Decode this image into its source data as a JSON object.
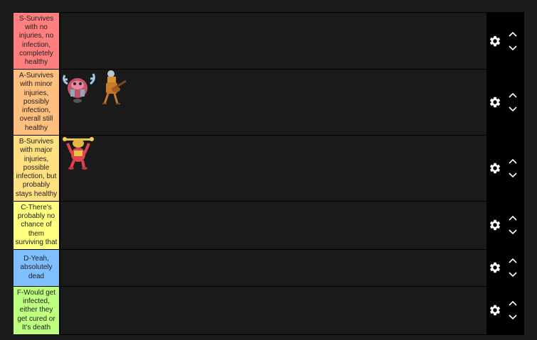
{
  "colors": {
    "background": "#1c1c1c",
    "row_bg": "#1a1a1a",
    "controls_bg": "#000000"
  },
  "tiers": [
    {
      "label": "S-Survives with no injuries, no infection, completely healthy",
      "color": "#ff7f7f"
    },
    {
      "label": "A-Survives with minor injuries, possibly infection, overall still healthy",
      "color": "#ffbf7f"
    },
    {
      "label": "B-Survives with major injuries, possible infection, but probably stays healthy",
      "color": "#ffdf7f"
    },
    {
      "label": "C-There's probably no chance of them surviving that",
      "color": "#ffff7f"
    },
    {
      "label": "D-Yeah, absolutely dead",
      "color": "#7fbfff"
    },
    {
      "label": "F-Would get infected, either they get cured or It's death",
      "color": "#bfff7f"
    }
  ],
  "icons": {
    "settings": "gear-icon",
    "move_up": "chevron-up-icon",
    "move_down": "chevron-down-icon"
  }
}
